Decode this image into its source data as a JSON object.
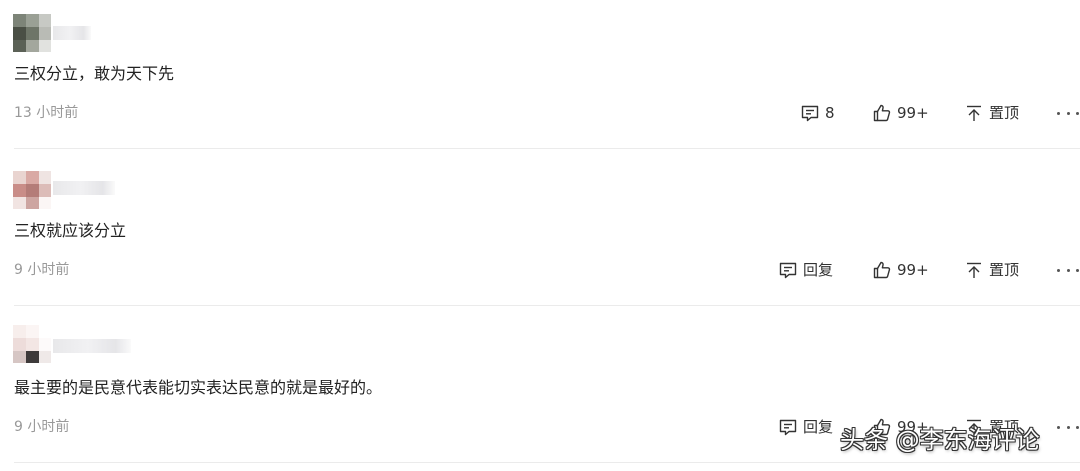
{
  "comments": [
    {
      "content": "三权分立，敢为天下先",
      "time": "13 小时前",
      "reply_label": "8",
      "like_label": "99+",
      "pin_label": "置顶"
    },
    {
      "content": "三权就应该分立",
      "time": "9 小时前",
      "reply_label": "回复",
      "like_label": "99+",
      "pin_label": "置顶"
    },
    {
      "content": "最主要的是民意代表能切实表达民意的就是最好的。",
      "time": "9 小时前",
      "reply_label": "回复",
      "like_label": "99+",
      "pin_label": "置顶"
    }
  ],
  "watermark": "头条 @李东海评论",
  "icons": {
    "reply": "comment-icon",
    "like": "thumbs-up-icon",
    "pin": "pin-top-icon",
    "more": "more-icon"
  },
  "colors": {
    "text": "#222222",
    "meta": "#999999",
    "action": "#333333",
    "divider": "#ebebeb"
  }
}
